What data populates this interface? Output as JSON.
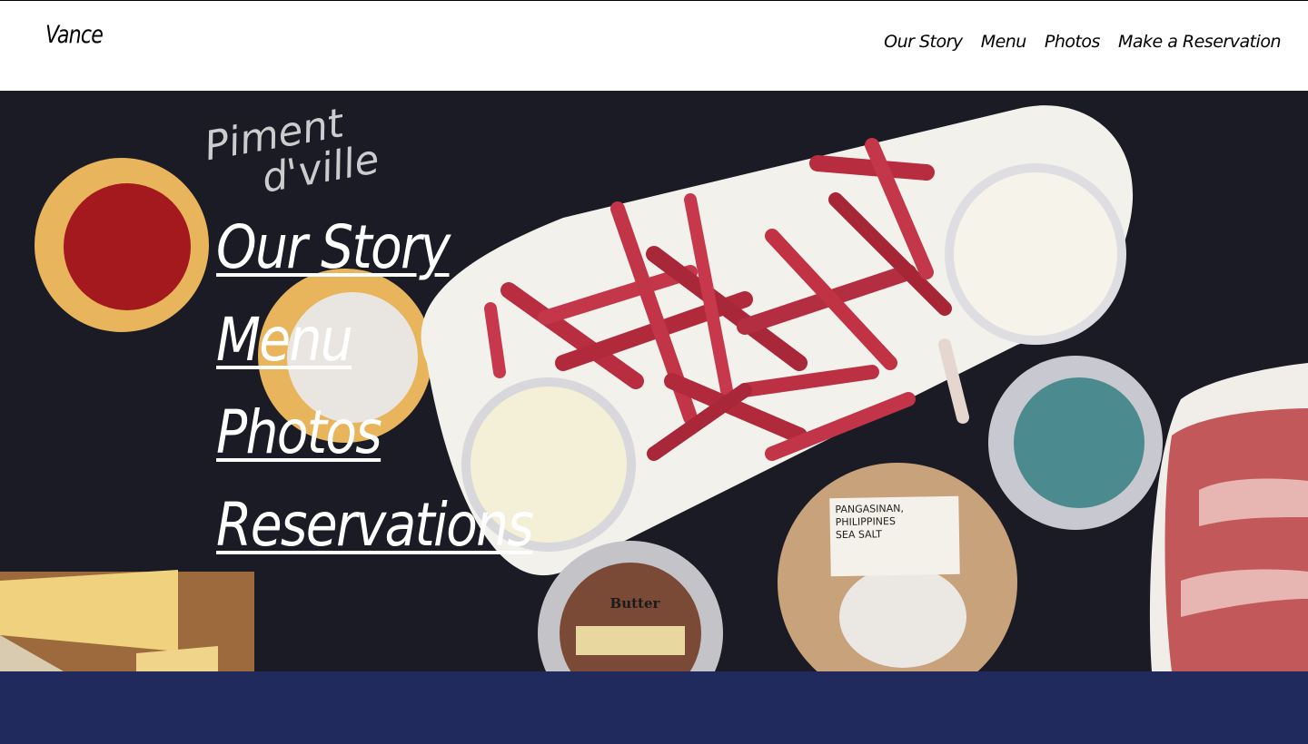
{
  "header": {
    "logo": "Vance",
    "nav": [
      "Our Story",
      "Menu",
      "Photos",
      "Make a Reservation"
    ]
  },
  "hero": {
    "chalk_lines": [
      "Piment",
      "d'ville"
    ],
    "salt_card_lines": [
      "PANGASINAN, PHILIPPINES",
      "SEA SALT"
    ],
    "butter_label": "Butter",
    "links": [
      "Our Story",
      "Menu",
      "Photos",
      "Reservations"
    ]
  },
  "colors": {
    "header_bg": "#ffffff",
    "hero_bg": "#1a1b24",
    "footer_band": "#202a5c",
    "link_text": "#ffffff"
  }
}
